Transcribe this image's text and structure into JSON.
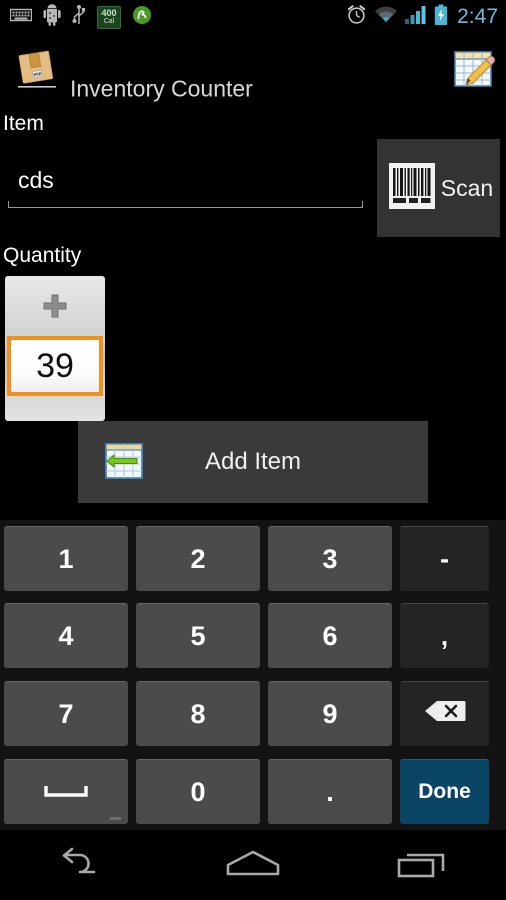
{
  "status_bar": {
    "left_icons": [
      {
        "name": "keyboard-icon",
        "glyph": "keyboard"
      },
      {
        "name": "android-debug-icon",
        "glyph": "android"
      },
      {
        "name": "usb-icon",
        "glyph": "usb"
      },
      {
        "name": "calorie-badge-icon",
        "value": "400",
        "unit": "Cal"
      },
      {
        "name": "evernote-icon",
        "glyph": "evernote"
      }
    ],
    "right_icons": [
      {
        "name": "alarm-icon"
      },
      {
        "name": "wifi-icon"
      },
      {
        "name": "cellular-signal-icon"
      },
      {
        "name": "battery-charging-icon"
      }
    ],
    "clock": "2:47"
  },
  "action_bar": {
    "app_icon": "package-box-icon",
    "title": "Inventory Counter",
    "action_icon": "spreadsheet-edit-icon"
  },
  "form": {
    "item": {
      "label": "Item",
      "value": "cds",
      "placeholder": ""
    },
    "scan": {
      "label": "Scan",
      "icon": "barcode-icon"
    },
    "quantity": {
      "label": "Quantity",
      "value": "39",
      "increment_glyph": "+",
      "increment_name": "increment-button",
      "decrement_name": "decrement-button"
    },
    "add_item": {
      "label": "Add Item",
      "icon": "spreadsheet-import-icon"
    }
  },
  "keyboard": {
    "rows": [
      [
        {
          "name": "key-1",
          "label": "1",
          "type": "num"
        },
        {
          "name": "key-2",
          "label": "2",
          "type": "num"
        },
        {
          "name": "key-3",
          "label": "3",
          "type": "num"
        },
        {
          "name": "key-minus",
          "label": "-",
          "type": "fn"
        }
      ],
      [
        {
          "name": "key-4",
          "label": "4",
          "type": "num"
        },
        {
          "name": "key-5",
          "label": "5",
          "type": "num"
        },
        {
          "name": "key-6",
          "label": "6",
          "type": "num"
        },
        {
          "name": "key-comma",
          "label": ",",
          "type": "fn"
        }
      ],
      [
        {
          "name": "key-7",
          "label": "7",
          "type": "num"
        },
        {
          "name": "key-8",
          "label": "8",
          "type": "num"
        },
        {
          "name": "key-9",
          "label": "9",
          "type": "num"
        },
        {
          "name": "key-backspace",
          "label": "",
          "type": "fn",
          "icon": "backspace-icon"
        }
      ],
      [
        {
          "name": "key-space",
          "label": "",
          "type": "num",
          "icon": "space-icon"
        },
        {
          "name": "key-0",
          "label": "0",
          "type": "num"
        },
        {
          "name": "key-period",
          "label": ".",
          "type": "num"
        },
        {
          "name": "key-done",
          "label": "Done",
          "type": "done"
        }
      ]
    ]
  },
  "nav_bar": {
    "buttons": [
      {
        "name": "nav-back-button",
        "icon": "back-arrow-icon"
      },
      {
        "name": "nav-home-button",
        "icon": "home-icon"
      },
      {
        "name": "nav-recents-button",
        "icon": "recents-icon"
      }
    ]
  },
  "colors": {
    "accent_orange": "#f0901f",
    "done_blue": "#0b4566",
    "key_gray": "#4b4b4b",
    "key_dark": "#242424",
    "clock_blue": "#6fb8e0"
  }
}
